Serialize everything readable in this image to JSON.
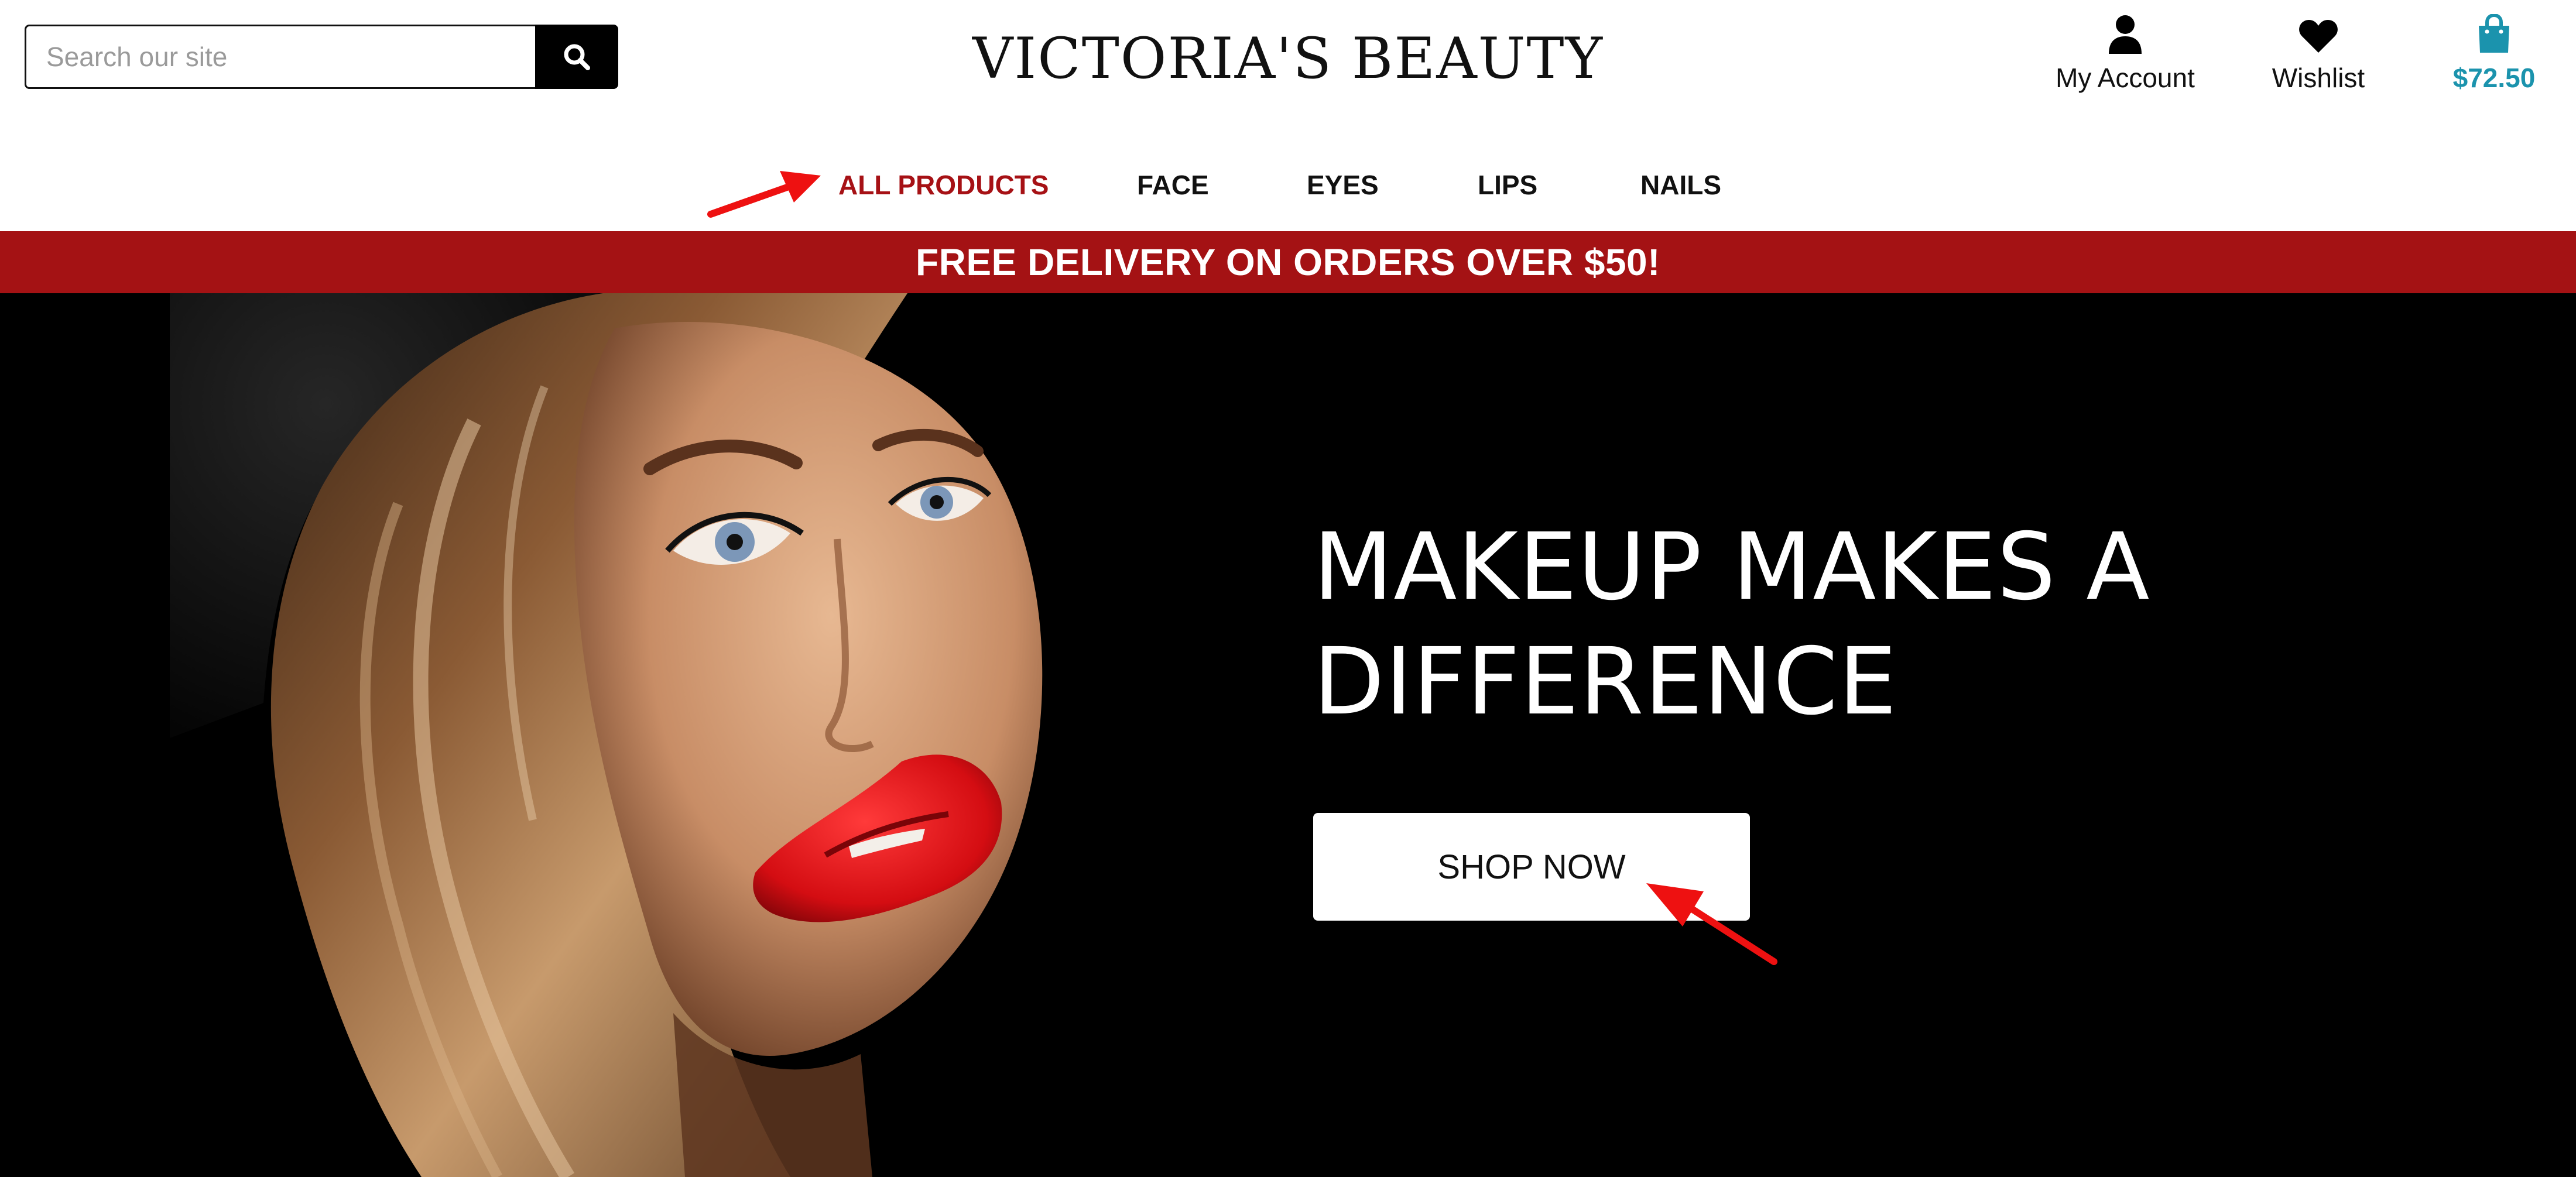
{
  "header": {
    "search": {
      "placeholder": "Search our site",
      "value": ""
    },
    "logo": "VICTORIA'S BEAUTY",
    "account_label": "My Account",
    "wishlist_label": "Wishlist",
    "bag_total": "$72.50"
  },
  "nav": {
    "items": [
      {
        "label": "ALL PRODUCTS",
        "active": true
      },
      {
        "label": "FACE",
        "active": false
      },
      {
        "label": "EYES",
        "active": false
      },
      {
        "label": "LIPS",
        "active": false
      },
      {
        "label": "NAILS",
        "active": false
      }
    ]
  },
  "banner": {
    "text": "FREE DELIVERY ON ORDERS OVER $50!"
  },
  "hero": {
    "title_line1": "MAKEUP MAKES A",
    "title_line2": "DIFFERENCE",
    "cta_label": "SHOP NOW"
  },
  "icons": {
    "search": "search-icon",
    "account": "user-icon",
    "wishlist": "heart-icon",
    "bag": "shopping-bag-icon",
    "annotation_arrows": "arrow-icon"
  },
  "colors": {
    "brand_red": "#a41214",
    "active_nav": "#a61115",
    "bag_teal": "#1b93ad",
    "annotation_arrow": "#ee1111",
    "hero_background": "#000000"
  }
}
